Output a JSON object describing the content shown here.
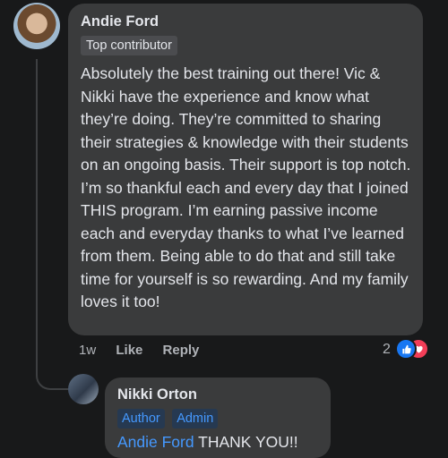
{
  "comment": {
    "author": "Andie Ford",
    "badge": "Top contributor",
    "text": "Absolutely the best training out there! Vic & Nikki have the experience and know what they’re doing. They’re committed to sharing their strategies & knowledge with their students on an ongoing basis. Their support is top notch. I’m so thankful each and every day that I joined THIS program. I’m earning passive income each and everyday thanks to what I’ve learned from them. Being able to do that and still take time for yourself is so rewarding. And my family loves it too!",
    "time": "1w",
    "like_label": "Like",
    "reply_label": "Reply",
    "reaction_count": "2",
    "reactions": [
      "like-icon",
      "love-icon"
    ],
    "colors": {
      "like": "#1877f2",
      "love": "#f33e58",
      "link": "#4599ff"
    }
  },
  "reply": {
    "author": "Nikki Orton",
    "badges": [
      "Author",
      "Admin"
    ],
    "mention": "Andie Ford",
    "text": " THANK YOU!!"
  }
}
